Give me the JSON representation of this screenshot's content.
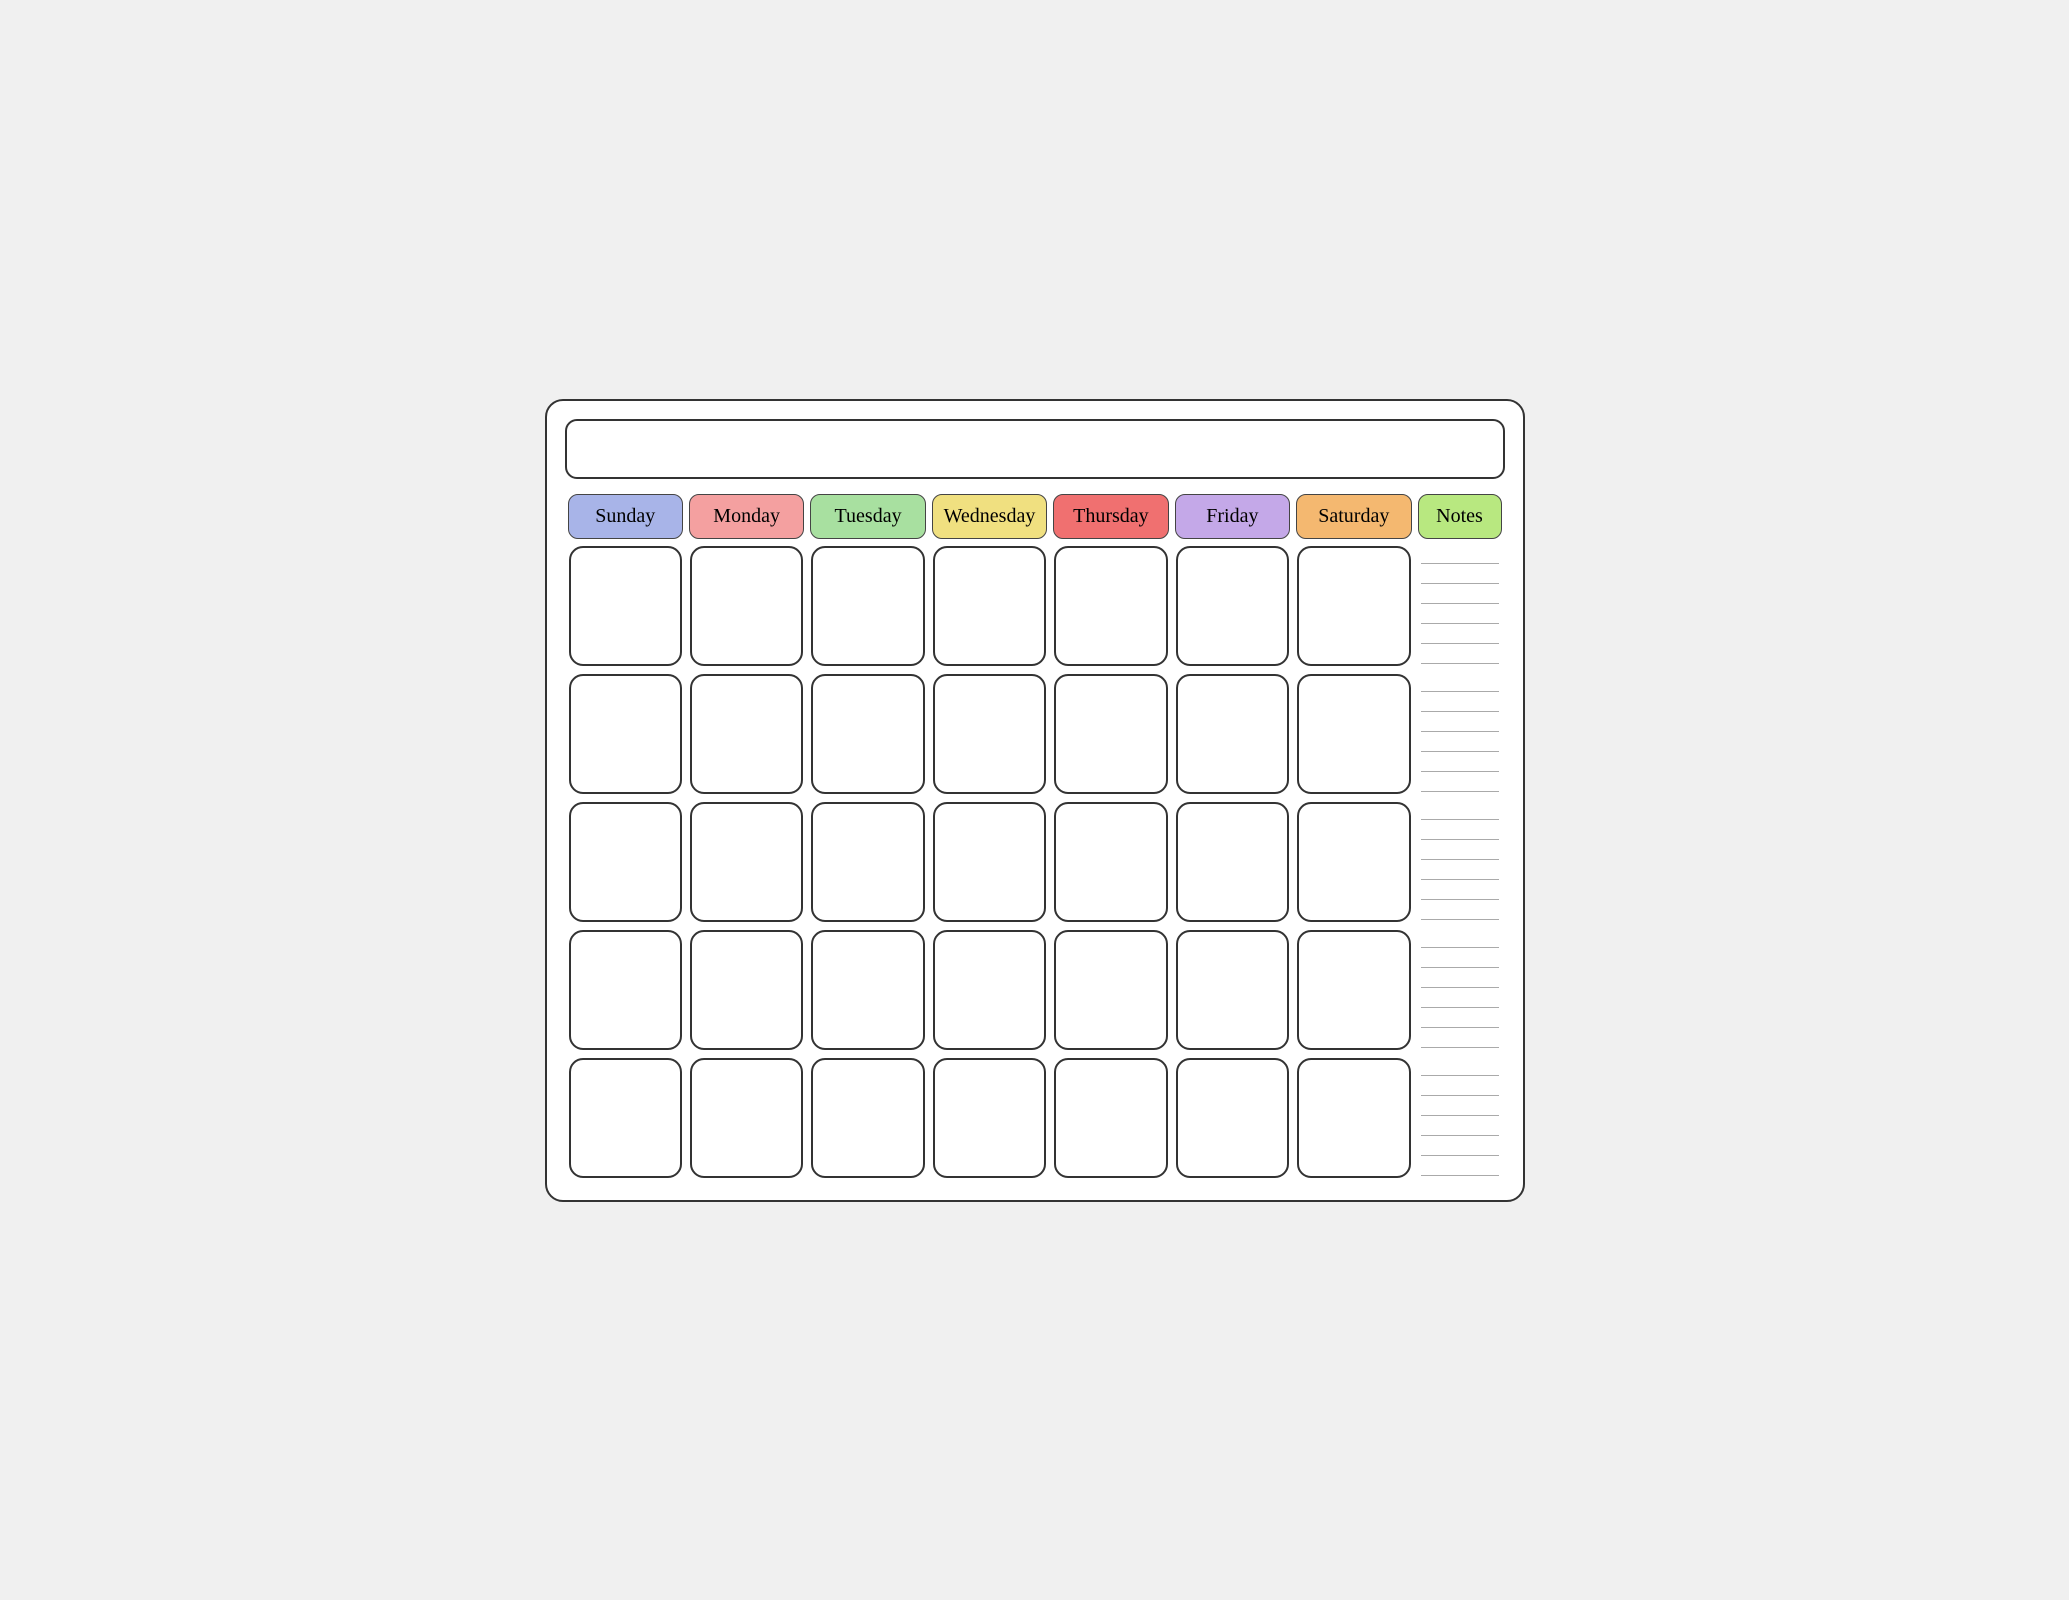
{
  "title": "",
  "headers": [
    {
      "id": "sunday",
      "label": "Sunday",
      "class": "header-sunday"
    },
    {
      "id": "monday",
      "label": "Monday",
      "class": "header-monday"
    },
    {
      "id": "tuesday",
      "label": "Tuesday",
      "class": "header-tuesday"
    },
    {
      "id": "wednesday",
      "label": "Wednesday",
      "class": "header-wednesday"
    },
    {
      "id": "thursday",
      "label": "Thursday",
      "class": "header-thursday"
    },
    {
      "id": "friday",
      "label": "Friday",
      "class": "header-friday"
    },
    {
      "id": "saturday",
      "label": "Saturday",
      "class": "header-saturday"
    }
  ],
  "notes_label": "Notes",
  "rows": 5,
  "cols": 7,
  "note_lines": 30,
  "colors": {
    "sunday": "#a8b4e8",
    "monday": "#f4a0a0",
    "tuesday": "#a8e0a0",
    "wednesday": "#f0e080",
    "thursday": "#f07070",
    "friday": "#c4a8e8",
    "saturday": "#f4b870",
    "notes": "#b8e880"
  }
}
